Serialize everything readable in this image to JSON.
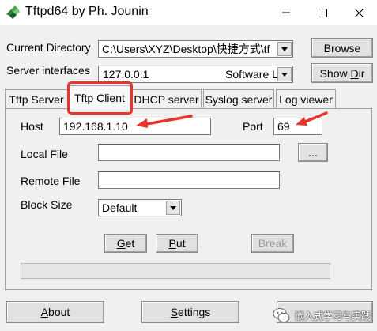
{
  "window": {
    "title": "Tftpd64 by Ph. Jounin",
    "icon": "tftpd-app-icon",
    "controls": [
      "minimize-icon",
      "maximize-icon",
      "close-icon"
    ]
  },
  "settings": {
    "current_directory_label": "Current Directory",
    "current_directory_value": "C:\\Users\\XYZ\\Desktop\\快捷方式\\tf",
    "browse_label": "Browse",
    "server_interfaces_label": "Server interfaces",
    "server_interface_ip": "127.0.0.1",
    "server_interface_name": "Software L",
    "show_dir_label": "Show Dir",
    "show_dir_mnemonic": "D",
    "show_dir_rest": "ir",
    "show_dir_prefix": "Show "
  },
  "tabs": [
    {
      "label": "Tftp Server",
      "active": false
    },
    {
      "label": "Tftp Client",
      "active": true
    },
    {
      "label": "DHCP server",
      "active": false
    },
    {
      "label": "Syslog server",
      "active": false
    },
    {
      "label": "Log viewer",
      "active": false
    }
  ],
  "client": {
    "host_label": "Host",
    "host_value": "192.168.1.10",
    "port_label": "Port",
    "port_value": "69",
    "local_file_label": "Local File",
    "local_file_value": "",
    "browse_small_label": "...",
    "remote_file_label": "Remote File",
    "remote_file_value": "",
    "block_size_label": "Block Size",
    "block_size_value": "Default",
    "get_label": "Get",
    "get_mnemonic": "G",
    "get_rest": "et",
    "put_label": "Put",
    "put_mnemonic": "P",
    "put_rest": "ut",
    "break_label": "Break",
    "progress": 0
  },
  "footer": {
    "about_label": "About",
    "about_mnemonic": "A",
    "about_rest": "bout",
    "settings_label": "Settings",
    "settings_mnemonic": "S",
    "settings_rest": "ettings"
  },
  "watermark": {
    "text": "嵌入式学习与实践",
    "icon": "wechat-icon"
  },
  "colors": {
    "annotation_red": "#e8342a",
    "window_bg": "#f0f0f0"
  }
}
